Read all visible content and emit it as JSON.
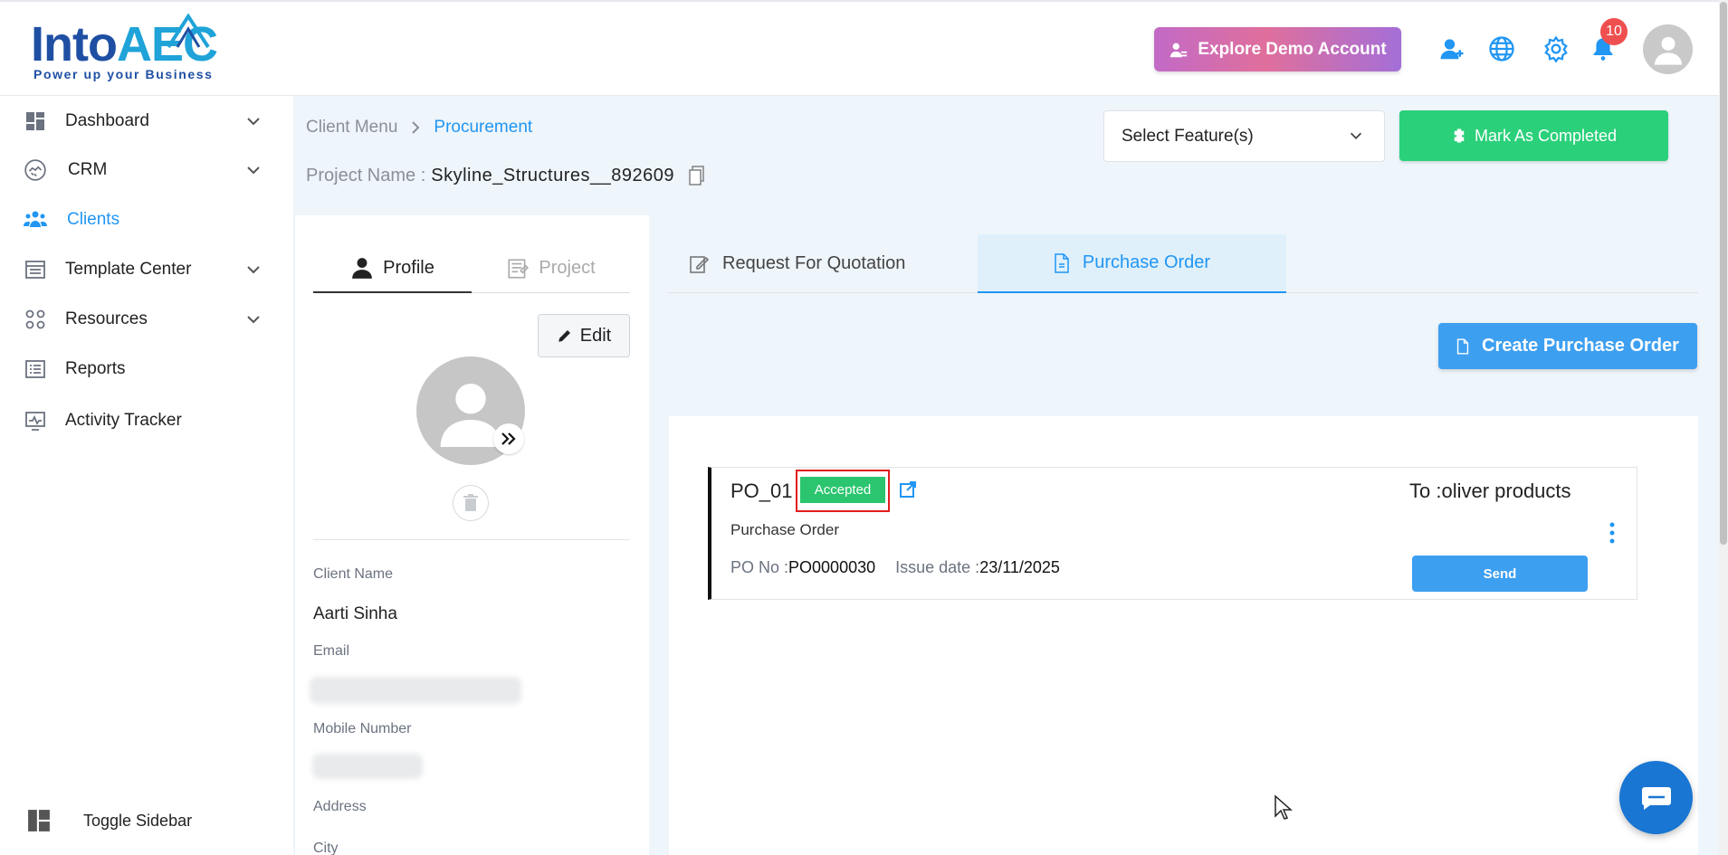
{
  "header": {
    "logo_into": "Into",
    "logo_aec": "AEC",
    "logo_tagline": "Power up your Business",
    "demo_button": "Explore Demo Account",
    "notification_count": "10",
    "icons": [
      "add-user-icon",
      "globe-icon",
      "gear-icon",
      "bell-icon",
      "avatar-icon"
    ]
  },
  "sidebar": {
    "items": [
      {
        "label": "Dashboard",
        "icon": "dashboard-icon",
        "expandable": true
      },
      {
        "label": "CRM",
        "icon": "handshake-icon",
        "expandable": true
      },
      {
        "label": "Clients",
        "icon": "clients-icon",
        "expandable": false,
        "active": true
      },
      {
        "label": "Template Center",
        "icon": "template-icon",
        "expandable": true
      },
      {
        "label": "Resources",
        "icon": "resources-icon",
        "expandable": true
      },
      {
        "label": "Reports",
        "icon": "reports-icon",
        "expandable": false
      },
      {
        "label": "Activity Tracker",
        "icon": "activity-icon",
        "expandable": false
      }
    ],
    "toggle_label": "Toggle Sidebar"
  },
  "breadcrumb": {
    "root": "Client Menu",
    "current": "Procurement"
  },
  "project": {
    "label": "Project Name :",
    "value": "Skyline_Structures__892609"
  },
  "toolbar": {
    "select_feature": "Select Feature(s)",
    "mark_completed": "Mark As Completed"
  },
  "profile": {
    "tabs": [
      "Profile",
      "Project"
    ],
    "edit_label": "Edit",
    "fields": {
      "client_name_label": "Client Name",
      "client_name_value": "Aarti Sinha",
      "email_label": "Email",
      "mobile_label": "Mobile Number",
      "address_label": "Address",
      "city_label": "City"
    }
  },
  "procurement_tabs": [
    "Request For Quotation",
    "Purchase Order"
  ],
  "create_po_label": "Create Purchase Order",
  "purchase_order": {
    "title": "PO_01",
    "status": "Accepted",
    "to_label": "To :",
    "to_value": "oliver products",
    "type": "Purchase Order",
    "po_no_label": "PO No :",
    "po_no_value": "PO0000030",
    "issue_date_label": "Issue date :",
    "issue_date_value": "23/11/2025",
    "send_label": "Send"
  },
  "colors": {
    "primary_blue": "#2196f3",
    "success_green": "#2bd07a",
    "badge_green": "#2cc56f",
    "highlight_red": "#e11d1d",
    "notification_red": "#ef4f4f"
  }
}
